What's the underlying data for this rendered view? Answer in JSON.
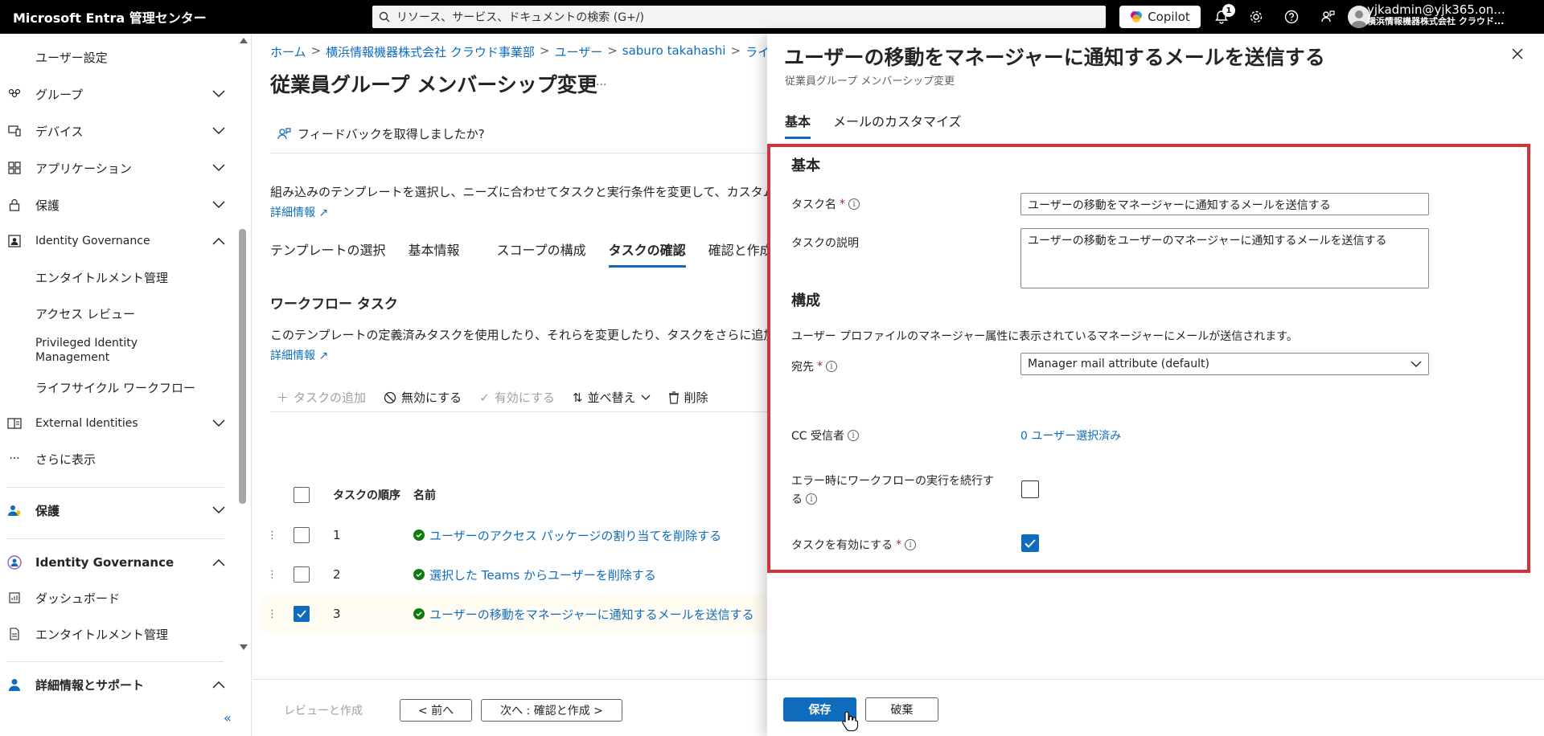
{
  "topbar": {
    "brand": "Microsoft Entra 管理センター",
    "search_placeholder": "リソース、サービス、ドキュメントの検索 (G+/)",
    "copilot_label": "Copilot",
    "notification_count": "1",
    "user_email": "yjkadmin@yjk365.on...",
    "user_org": "横浜情報機器株式会社 クラウド..."
  },
  "sidebar": {
    "items": [
      {
        "label": "ユーザー設定"
      },
      {
        "label": "グループ"
      },
      {
        "label": "デバイス"
      },
      {
        "label": "アプリケーション"
      },
      {
        "label": "保護"
      },
      {
        "label": "Identity Governance"
      },
      {
        "label": "エンタイトルメント管理"
      },
      {
        "label": "アクセス レビュー"
      },
      {
        "label": "Privileged Identity Management"
      },
      {
        "label": "ライフサイクル ワークフロー"
      },
      {
        "label": "External Identities"
      },
      {
        "label": "さらに表示"
      },
      {
        "label": "保護"
      },
      {
        "label": "Identity Governance"
      },
      {
        "label": "ダッシュボード"
      },
      {
        "label": "エンタイトルメント管理"
      },
      {
        "label": "詳細情報とサポート"
      }
    ],
    "collapse_label": "«"
  },
  "main": {
    "breadcrumb": [
      "ホーム",
      "横浜情報機器株式会社 クラウド事業部",
      "ユーザー",
      "saburo takahashi",
      "ライフ"
    ],
    "title": "従業員グループ メンバーシップ変更",
    "more": "...",
    "feedback": "フィードバックを取得しましたか?",
    "desc1": "組み込みのテンプレートを選択し、ニーズに合わせてタスクと実行条件を変更して、カスタム",
    "learn_more": "詳細情報",
    "tabs": [
      "テンプレートの選択",
      "基本情報",
      "スコープの構成",
      "タスクの確認",
      "確認と作成"
    ],
    "section_title": "ワークフロー タスク",
    "desc2": "このテンプレートの定義済みタスクを使用したり、それらを変更したり、タスクをさらに追加",
    "learn_more2": "詳細情報",
    "toolbar": {
      "add": "タスクの追加",
      "disable": "無効にする",
      "enable": "有効にする",
      "sort": "並べ替え",
      "delete": "削除"
    },
    "table": {
      "col_order": "タスクの順序",
      "col_name": "名前",
      "rows": [
        {
          "order": "1",
          "name": "ユーザーのアクセス パッケージの割り当てを削除する"
        },
        {
          "order": "2",
          "name": "選択した Teams からユーザーを削除する"
        },
        {
          "order": "3",
          "name": "ユーザーの移動をマネージャーに通知するメールを送信する"
        }
      ]
    },
    "footer": {
      "review": "レビューと作成",
      "prev": "< 前へ",
      "next": "次へ : 確認と作成 >"
    }
  },
  "panel": {
    "title": "ユーザーの移動をマネージャーに通知するメールを送信する",
    "subtitle": "従業員グループ メンバーシップ変更",
    "tabs": [
      "基本",
      "メールのカスタマイズ"
    ],
    "section_basic": "基本",
    "task_name_label": "タスク名",
    "task_name_value": "ユーザーの移動をマネージャーに通知するメールを送信する",
    "task_desc_label": "タスクの説明",
    "task_desc_value": "ユーザーの移動をユーザーのマネージャーに通知するメールを送信する",
    "section_config": "構成",
    "config_desc": "ユーザー プロファイルのマネージャー属性に表示されているマネージャーにメールが送信されます。",
    "to_label": "宛先",
    "to_value": "Manager mail attribute (default)",
    "cc_label": "CC 受信者",
    "cc_value": "0 ユーザー選択済み",
    "continue_label_1": "エラー時にワークフローの実行を続行す",
    "continue_label_2": "る",
    "enable_label": "タスクを有効にする",
    "save": "保存",
    "discard": "破棄"
  },
  "colors": {
    "accent": "#0f6cbd",
    "highlight_border": "#d13438",
    "success": "#107c10"
  }
}
